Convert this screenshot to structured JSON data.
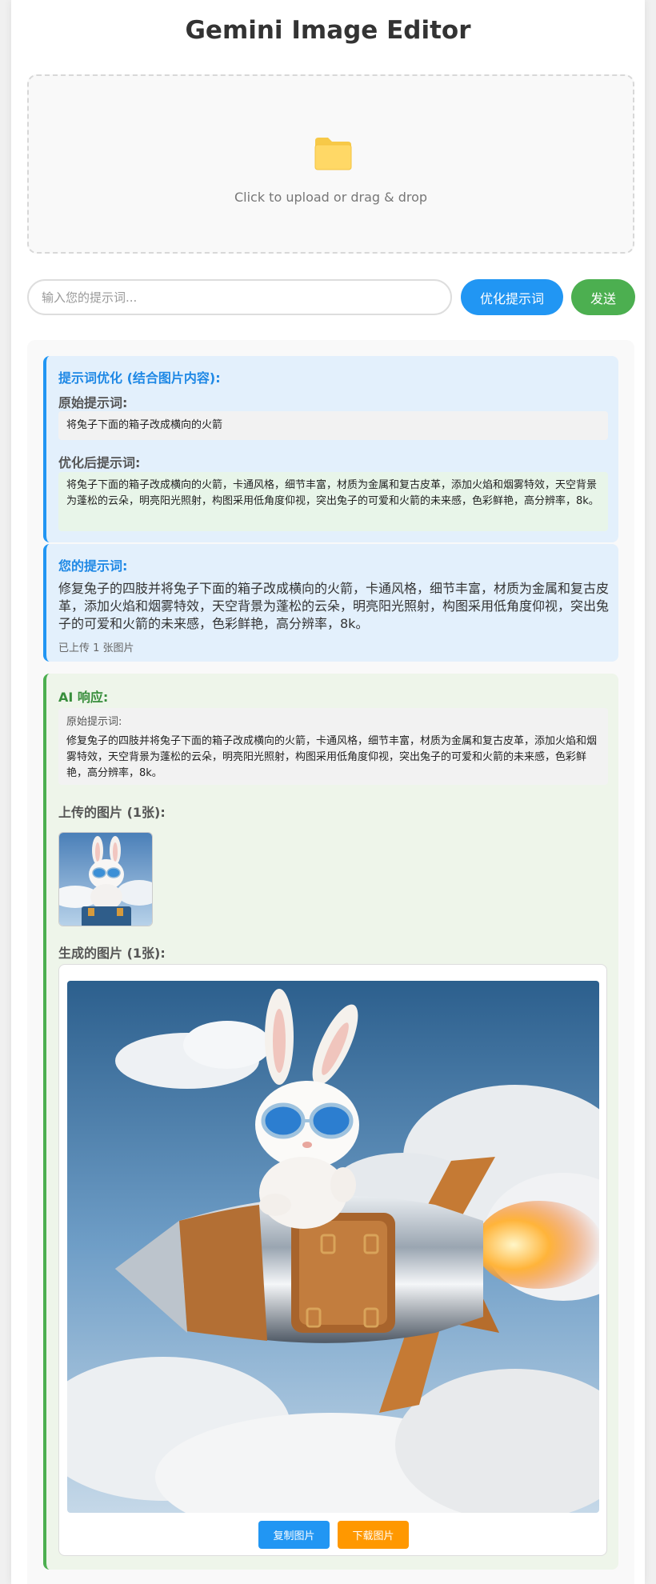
{
  "app": {
    "title": "Gemini Image Editor"
  },
  "upload": {
    "text": "Click to upload or drag & drop",
    "icon": "folder-icon"
  },
  "prompt_bar": {
    "placeholder": "输入您的提示词...",
    "optimize_label": "优化提示词",
    "send_label": "发送"
  },
  "colors": {
    "primary": "#2196f3",
    "success": "#4caf50",
    "warning": "#ff9800"
  },
  "optimize_msg": {
    "heading": "提示词优化 (结合图片内容):",
    "original_label": "原始提示词:",
    "original_text": "将兔子下面的箱子改成横向的火箭",
    "optimized_label": "优化后提示词:",
    "optimized_text": "将兔子下面的箱子改成横向的火箭，卡通风格，细节丰富，材质为金属和复古皮革，添加火焰和烟雾特效，天空背景为蓬松的云朵，明亮阳光照射，构图采用低角度仰视，突出兔子的可爱和火箭的未来感，色彩鲜艳，高分辨率，8k。"
  },
  "user_msg": {
    "heading": "您的提示词:",
    "text": "修复兔子的四肢并将兔子下面的箱子改成横向的火箭，卡通风格，细节丰富，材质为金属和复古皮革，添加火焰和烟雾特效，天空背景为蓬松的云朵，明亮阳光照射，构图采用低角度仰视，突出兔子的可爱和火箭的未来感，色彩鲜艳，高分辨率，8k。",
    "status": "已上传 1 张图片"
  },
  "ai_msg": {
    "heading": "AI 响应:",
    "original_label": "原始提示词:",
    "original_text": "修复兔子的四肢并将兔子下面的箱子改成横向的火箭，卡通风格，细节丰富，材质为金属和复古皮革，添加火焰和烟雾特效，天空背景为蓬松的云朵，明亮阳光照射，构图采用低角度仰视，突出兔子的可爱和火箭的未来感，色彩鲜艳，高分辨率，8k。",
    "uploaded_label": "上传的图片 (1张):",
    "generated_label": "生成的图片 (1张):",
    "copy_label": "复制图片",
    "download_label": "下载图片"
  }
}
